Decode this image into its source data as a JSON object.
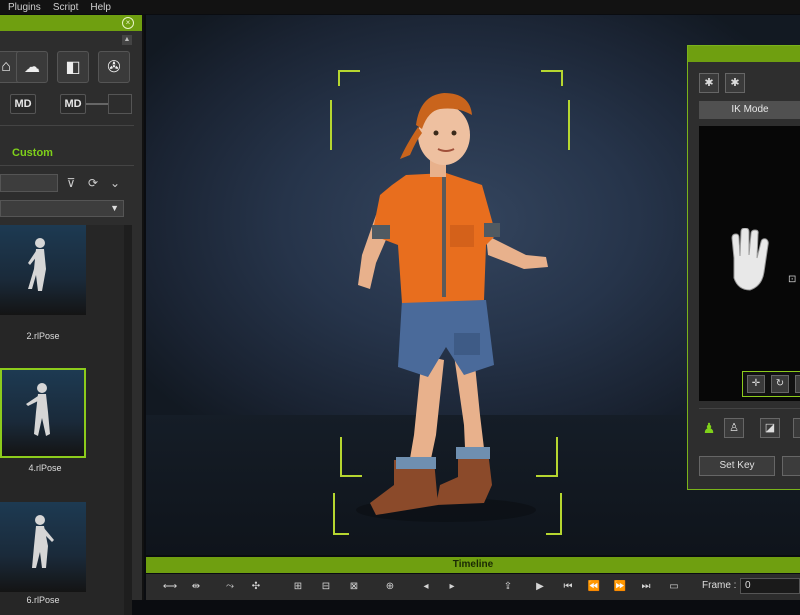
{
  "menu": [
    "Plugins",
    "Script",
    "Help"
  ],
  "left_panel": {
    "custom_label": "Custom",
    "tool_icons": [
      "accessory-icon",
      "cloud-icon",
      "shapes-icon",
      "film-reel-icon"
    ],
    "md_buttons": [
      "MD",
      "MD"
    ],
    "poses": [
      {
        "label": "2.rlPose",
        "selected": false
      },
      {
        "label": "4.rlPose",
        "selected": true
      },
      {
        "label": "6.rlPose",
        "selected": false
      }
    ]
  },
  "right_panel": {
    "ik_mode_label": "IK Mode",
    "set_key_label": "Set Key"
  },
  "timeline": {
    "title": "Timeline",
    "frame_label": "Frame :",
    "frame_value": "0"
  },
  "colors": {
    "accent": "#6f9f10",
    "selection": "#8ccb1c",
    "bracket": "#b6d630"
  }
}
